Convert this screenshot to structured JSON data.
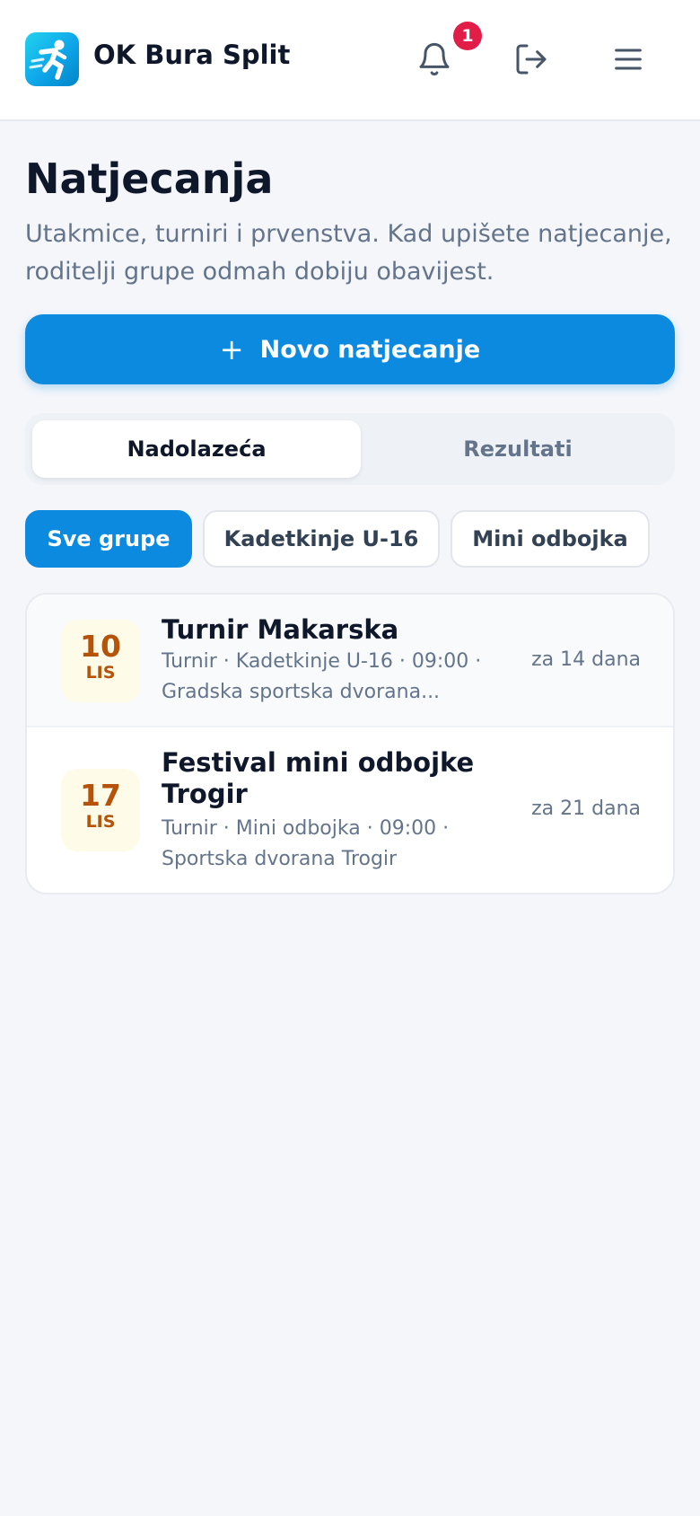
{
  "header": {
    "brand": "OK Bura Split",
    "notifications_count": "1",
    "icons": {
      "logo": "running-figure-icon",
      "bell": "bell-icon",
      "logout": "logout-icon",
      "menu": "hamburger-menu-icon"
    }
  },
  "page": {
    "title": "Natjecanja",
    "subtitle": "Utakmice, turniri i prvenstva. Kad upišete natjecanje, roditelji grupe odmah dobiju obavijest."
  },
  "new_button": {
    "icon": "+",
    "label": "Novo natjecanje"
  },
  "segments": [
    {
      "label": "Nadolazeća",
      "active": true
    },
    {
      "label": "Rezultati",
      "active": false
    }
  ],
  "filters": [
    {
      "label": "Sve grupe",
      "active": true
    },
    {
      "label": "Kadetkinje U-16",
      "active": false
    },
    {
      "label": "Mini odbojka",
      "active": false
    }
  ],
  "events": [
    {
      "day": "10",
      "month": "LIS",
      "title": "Turnir Makarska",
      "meta_line1": "Turnir · Kadetkinje U-16 · 09:00 ·",
      "meta_line2": "Gradska sportska dvorana...",
      "when": "za 14 dana"
    },
    {
      "day": "17",
      "month": "LIS",
      "title": "Festival mini odbojke Trogir",
      "meta_line1": "Turnir · Mini odbojka · 09:00 ·",
      "meta_line2": "Sportska dvorana Trogir",
      "when": "za 21 dana"
    }
  ],
  "colors": {
    "accent": "#0b8ae0",
    "badge": "#e11d48",
    "date_text": "#b45309",
    "date_bg": "#fefce8",
    "muted": "#64748b"
  }
}
